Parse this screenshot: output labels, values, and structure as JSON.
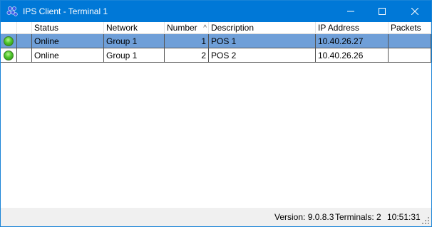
{
  "window": {
    "title": "IPS Client - Terminal 1"
  },
  "table": {
    "columns": [
      "",
      "",
      "Status",
      "Network",
      "Number",
      "Description",
      "IP Address",
      "Packets"
    ],
    "sort_indicator": "^",
    "rows": [
      {
        "status_icon": "green-led-icon",
        "status": "Online",
        "network": "Group 1",
        "number": "1",
        "description": "POS 1",
        "ip": "10.40.26.27",
        "packets": "",
        "selected": true
      },
      {
        "status_icon": "green-led-icon",
        "status": "Online",
        "network": "Group 1",
        "number": "2",
        "description": "POS 2",
        "ip": "10.40.26.26",
        "packets": "",
        "selected": false
      }
    ]
  },
  "statusbar": {
    "version": "Version: 9.0.8.3",
    "terminals": "Terminals: 2",
    "time": "10:51:31"
  },
  "colors": {
    "titlebar": "#0078d7",
    "selected_row": "#6f9fd8",
    "online_led": "#4cc52a"
  }
}
